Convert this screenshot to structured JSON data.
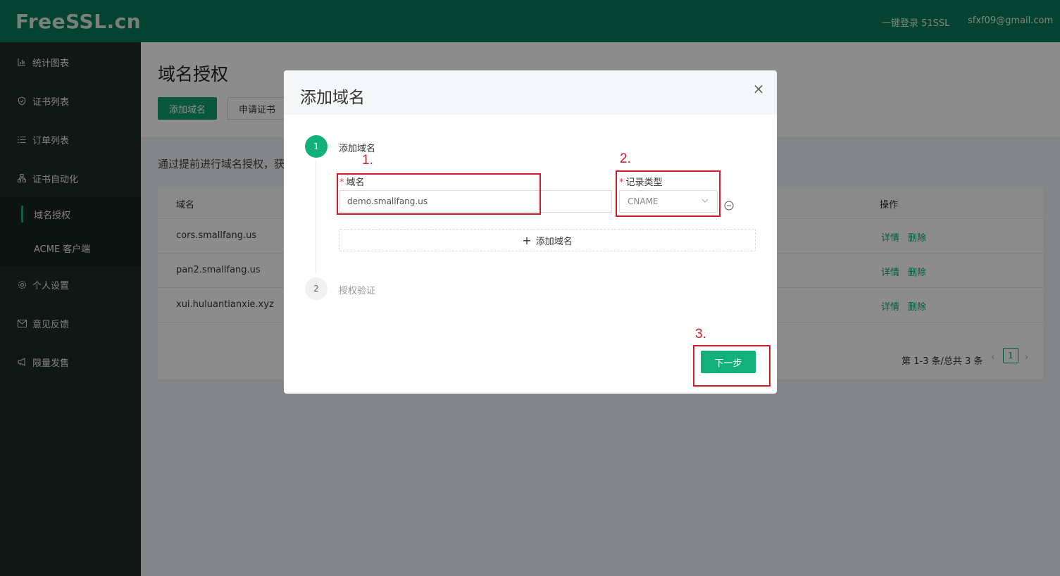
{
  "header": {
    "logo": "FreeSSL.cn",
    "links": [
      "一键登录 51SSL",
      "sfxf09@gmail.com"
    ]
  },
  "sidebar": {
    "items": [
      {
        "label": "统计图表",
        "icon": "bar-chart-icon"
      },
      {
        "label": "证书列表",
        "icon": "shield-icon"
      },
      {
        "label": "订单列表",
        "icon": "list-icon"
      },
      {
        "label": "证书自动化",
        "icon": "cluster-icon"
      },
      {
        "label": "个人设置",
        "icon": "gear-icon"
      },
      {
        "label": "意见反馈",
        "icon": "mail-icon"
      },
      {
        "label": "限量发售",
        "icon": "megaphone-icon"
      }
    ],
    "subitems": [
      {
        "label": "域名授权",
        "active": true
      },
      {
        "label": "ACME 客户端",
        "active": false
      }
    ]
  },
  "page": {
    "title": "域名授权",
    "add_button": "添加域名",
    "apply_button": "申请证书",
    "description": "通过提前进行域名授权，获"
  },
  "table": {
    "headers": {
      "domain": "域名",
      "action": "操作"
    },
    "rows": [
      {
        "domain": "cors.smallfang.us",
        "detail": "详情",
        "delete": "删除"
      },
      {
        "domain": "pan2.smallfang.us",
        "detail": "详情",
        "delete": "删除"
      },
      {
        "domain": "xui.huluantianxie.xyz",
        "detail": "详情",
        "delete": "删除"
      }
    ],
    "pagination": {
      "summary": "第 1-3 条/总共 3 条",
      "current_page": "1",
      "prev": "‹",
      "next": "›"
    }
  },
  "modal": {
    "title": "添加域名",
    "close": "×",
    "steps": [
      {
        "number": "1",
        "title": "添加域名"
      },
      {
        "number": "2",
        "title": "授权验证"
      }
    ],
    "form": {
      "required_mark": "*",
      "domain_label": "域名",
      "domain_value": "demo.smallfang.us",
      "type_label": "记录类型",
      "type_value": "CNAME",
      "add_domain_label": "添加域名",
      "add_domain_plus": "+"
    },
    "next_button": "下一步"
  },
  "annotations": [
    "1.",
    "2.",
    "3."
  ],
  "colors": {
    "brand_header": "#077a57",
    "primary": "#11b07a",
    "sidebar": "#1f2a26",
    "annotation": "#d11a2a"
  }
}
